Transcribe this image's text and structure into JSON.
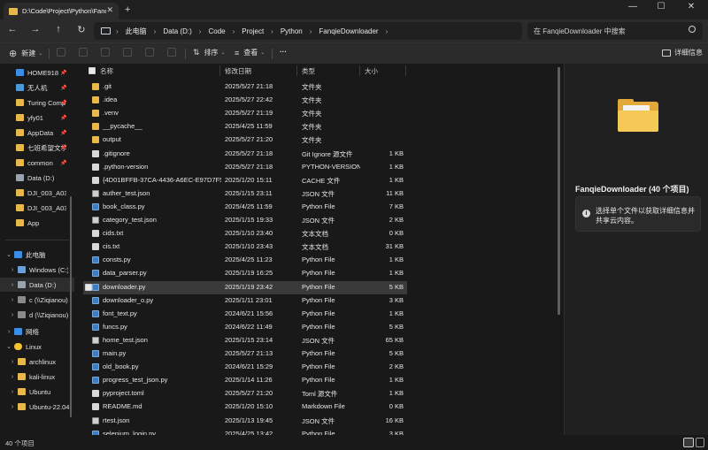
{
  "window": {
    "tab_title": "D:\\Code\\Project\\Python\\Fanqi",
    "tab_close": "✕",
    "new_tab": "+",
    "minimize": "—",
    "maximize": "☐",
    "close": "✕"
  },
  "nav": {
    "back": "←",
    "forward": "→",
    "up": "↑",
    "refresh": "↻"
  },
  "address": {
    "crumbs": [
      "此电脑",
      "Data (D:)",
      "Code",
      "Project",
      "Python",
      "FanqieDownloader"
    ],
    "separator": "›"
  },
  "search": {
    "placeholder": "在 FanqieDownloader 中搜索"
  },
  "toolbar": {
    "new_label": "新建",
    "sort_label": "排序",
    "view_label": "查看",
    "more_label": "···",
    "details_label": "详细信息"
  },
  "sidebar": {
    "quick": [
      "HOME918",
      "无人机",
      "Turing Comp",
      "yfy01",
      "AppData",
      "七班希望文学",
      "common",
      "Data (D:)",
      "DJI_003_A03",
      "DJI_003_A03",
      "App"
    ],
    "thispc": "此电脑",
    "drives": [
      "Windows (C:)",
      "Data (D:)",
      "c (\\\\Ziqianou)",
      "d (\\\\Ziqianou)"
    ],
    "network": "网络",
    "linux": "Linux",
    "distros": [
      "archlinux",
      "kali-linux",
      "Ubuntu",
      "Ubuntu-22.04"
    ]
  },
  "columns": {
    "name": "名称",
    "date": "修改日期",
    "type": "类型",
    "size": "大小"
  },
  "files": [
    {
      "name": ".git",
      "date": "2025/5/27 21:18",
      "type": "文件夹",
      "size": "",
      "kind": "folder"
    },
    {
      "name": ".idea",
      "date": "2025/5/27 22:42",
      "type": "文件夹",
      "size": "",
      "kind": "folder"
    },
    {
      "name": ".venv",
      "date": "2025/5/27 21:19",
      "type": "文件夹",
      "size": "",
      "kind": "folder"
    },
    {
      "name": "__pycache__",
      "date": "2025/4/25 11:59",
      "type": "文件夹",
      "size": "",
      "kind": "folder"
    },
    {
      "name": "output",
      "date": "2025/5/27 21:20",
      "type": "文件夹",
      "size": "",
      "kind": "folder"
    },
    {
      "name": ".gitignore",
      "date": "2025/5/27 21:18",
      "type": "Git Ignore 源文件",
      "size": "1 KB",
      "kind": "doc"
    },
    {
      "name": ".python-version",
      "date": "2025/5/27 21:18",
      "type": "PYTHON-VERSION...",
      "size": "1 KB",
      "kind": "doc"
    },
    {
      "name": "{4D01BFFB-37CA-4436-A6EC-E97D7F52...",
      "date": "2025/1/20 15:11",
      "type": "CACHE 文件",
      "size": "1 KB",
      "kind": "doc"
    },
    {
      "name": "auther_test.json",
      "date": "2025/1/15 23:11",
      "type": "JSON 文件",
      "size": "11 KB",
      "kind": "json"
    },
    {
      "name": "book_class.py",
      "date": "2025/4/25 11:59",
      "type": "Python File",
      "size": "7 KB",
      "kind": "py"
    },
    {
      "name": "category_test.json",
      "date": "2025/1/15 19:33",
      "type": "JSON 文件",
      "size": "2 KB",
      "kind": "json"
    },
    {
      "name": "cids.txt",
      "date": "2025/1/10 23:40",
      "type": "文本文档",
      "size": "0 KB",
      "kind": "doc"
    },
    {
      "name": "cis.txt",
      "date": "2025/1/10 23:43",
      "type": "文本文档",
      "size": "31 KB",
      "kind": "doc"
    },
    {
      "name": "consts.py",
      "date": "2025/4/25 11:23",
      "type": "Python File",
      "size": "1 KB",
      "kind": "py"
    },
    {
      "name": "data_parser.py",
      "date": "2025/1/19 16:25",
      "type": "Python File",
      "size": "1 KB",
      "kind": "py"
    },
    {
      "name": "downloader.py",
      "date": "2025/1/19 23:42",
      "type": "Python File",
      "size": "5 KB",
      "kind": "py",
      "selected": true
    },
    {
      "name": "downloader_o.py",
      "date": "2025/1/11 23:01",
      "type": "Python File",
      "size": "3 KB",
      "kind": "py"
    },
    {
      "name": "font_text.py",
      "date": "2024/6/21 15:56",
      "type": "Python File",
      "size": "1 KB",
      "kind": "py"
    },
    {
      "name": "funcs.py",
      "date": "2024/6/22 11:49",
      "type": "Python File",
      "size": "5 KB",
      "kind": "py"
    },
    {
      "name": "home_test.json",
      "date": "2025/1/15 23:14",
      "type": "JSON 文件",
      "size": "65 KB",
      "kind": "json"
    },
    {
      "name": "main.py",
      "date": "2025/5/27 21:13",
      "type": "Python File",
      "size": "5 KB",
      "kind": "py"
    },
    {
      "name": "old_book.py",
      "date": "2024/6/21 15:29",
      "type": "Python File",
      "size": "2 KB",
      "kind": "py"
    },
    {
      "name": "progress_test_json.py",
      "date": "2025/1/14 11:26",
      "type": "Python File",
      "size": "1 KB",
      "kind": "py"
    },
    {
      "name": "pyproject.toml",
      "date": "2025/5/27 21:20",
      "type": "Toml 源文件",
      "size": "1 KB",
      "kind": "doc"
    },
    {
      "name": "README.md",
      "date": "2025/1/20 15:10",
      "type": "Markdown File",
      "size": "0 KB",
      "kind": "doc"
    },
    {
      "name": "rtest.json",
      "date": "2025/1/13 19:45",
      "type": "JSON 文件",
      "size": "16 KB",
      "kind": "json"
    },
    {
      "name": "selenium_login.py",
      "date": "2025/4/25 13:42",
      "type": "Python File",
      "size": "3 KB",
      "kind": "py"
    }
  ],
  "details": {
    "title": "FanqieDownloader (40 个项目)",
    "message": "选择单个文件以获取详细信息并共享云内容。",
    "info_glyph": "i"
  },
  "status": {
    "count": "40 个项目"
  }
}
